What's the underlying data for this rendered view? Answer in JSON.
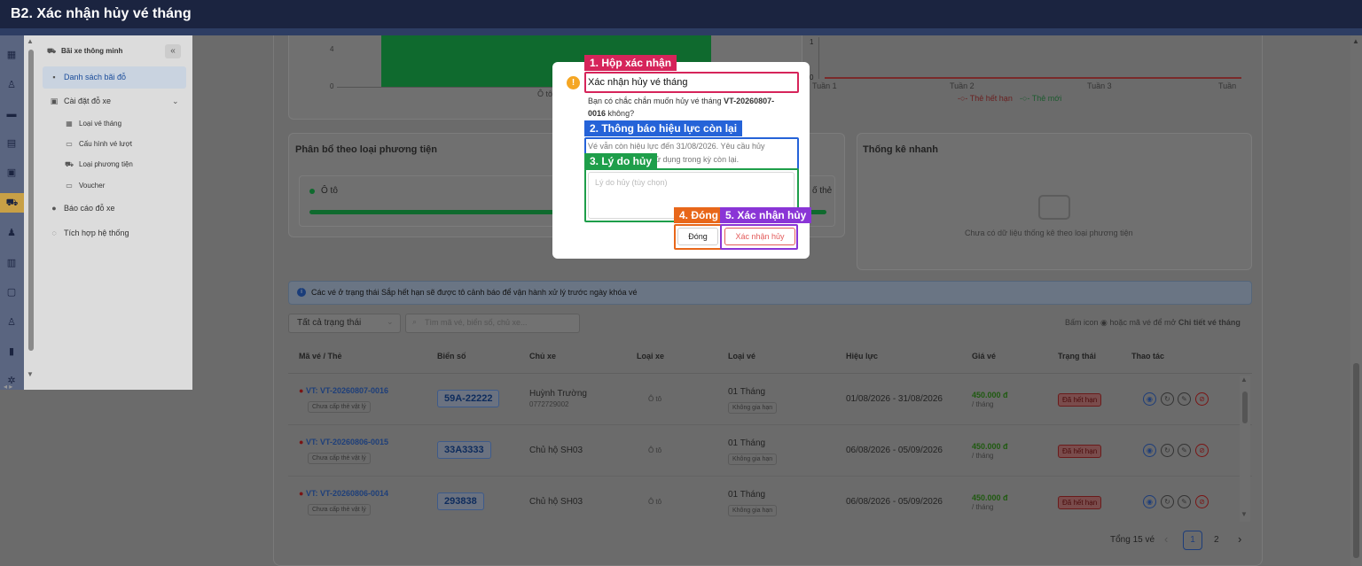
{
  "header": {
    "title": "B2. Xác nhận hủy vé tháng"
  },
  "sidebar": {
    "module": "Bãi xe thông minh",
    "items": [
      {
        "label": "Danh sách bãi đỗ"
      },
      {
        "label": "Cài đặt đỗ xe"
      },
      {
        "label": "Loại vé tháng"
      },
      {
        "label": "Cấu hình vé lượt"
      },
      {
        "label": "Loại phương tiện"
      },
      {
        "label": "Voucher"
      },
      {
        "label": "Báo cáo đỗ xe"
      },
      {
        "label": "Tích hợp hệ thống"
      }
    ]
  },
  "chart_top_left": {
    "y_ticks": [
      "4",
      "0"
    ],
    "x_label": "Ô tô"
  },
  "chart_top_right": {
    "y_ticks": [
      "1",
      "0"
    ],
    "x_labels": [
      "Tuần 1",
      "Tuần 2",
      "Tuần 3",
      "Tuần"
    ],
    "legend": [
      "Thẻ hết hạn",
      "Thẻ mới"
    ]
  },
  "vehicle_card": {
    "title": "Phân bổ theo loại phương tiện",
    "item": "Ô tô",
    "right_text": "ố thẻ"
  },
  "stats_card": {
    "title": "Thống kê nhanh",
    "empty": "Chưa có dữ liệu thống kê theo loại phương tiện"
  },
  "info": {
    "text": "Các vé ở trạng thái Sắp hết hạn sẽ được tô cảnh báo để vận hành xử lý trước ngày khóa vé"
  },
  "filters": {
    "status": "Tất cả trạng thái",
    "search_placeholder": "Tìm mã vé, biển số, chủ xe...",
    "hint_prefix": "Bấm icon",
    "hint_middle": "hoặc mã vé để mở",
    "hint_bold": "Chi tiết vé tháng"
  },
  "table": {
    "headers": [
      "Mã vé / Thẻ",
      "Biển số",
      "Chủ xe",
      "Loại xe",
      "Loại vé",
      "Hiệu lực",
      "Giá vé",
      "Trạng thái",
      "Thao tác"
    ],
    "rows": [
      {
        "code": "VT: VT-20260807-0016",
        "card": "Chưa cấp thẻ vật lý",
        "plate": "59A-22222",
        "owner": "Huỳnh Trường",
        "phone": "0772729002",
        "vtype": "Ô tô",
        "ticket": "01 Tháng",
        "ticket_sub": "Không gia hạn",
        "validity": "01/08/2026 - 31/08/2026",
        "price": "450.000 đ",
        "per": "/ tháng",
        "status": "Đã hết hạn"
      },
      {
        "code": "VT: VT-20260806-0015",
        "card": "Chưa cấp thẻ vật lý",
        "plate": "33A3333",
        "owner": "Chủ hộ SH03",
        "phone": "",
        "vtype": "Ô tô",
        "ticket": "01 Tháng",
        "ticket_sub": "Không gia hạn",
        "validity": "06/08/2026 - 05/09/2026",
        "price": "450.000 đ",
        "per": "/ tháng",
        "status": "Đã hết hạn"
      },
      {
        "code": "VT: VT-20260806-0014",
        "card": "Chưa cấp thẻ vật lý",
        "plate": "293838",
        "owner": "Chủ hộ SH03",
        "phone": "",
        "vtype": "Ô tô",
        "ticket": "01 Tháng",
        "ticket_sub": "Không gia hạn",
        "validity": "06/08/2026 - 05/09/2026",
        "price": "450.000 đ",
        "per": "/ tháng",
        "status": "Đã hết hạn"
      }
    ]
  },
  "pagination": {
    "total": "Tổng 15 vé",
    "pages": [
      "1",
      "2"
    ],
    "prev": "‹",
    "next": "›"
  },
  "modal": {
    "title": "Xác nhận hủy vé tháng",
    "question_prefix": "Bạn có chắc chắn muốn hủy vé tháng",
    "ticket_code_1": "VT-20260807-",
    "ticket_code_2": "0016",
    "question_suffix": "không?",
    "notice_1": "Vé vẫn còn hiệu lực đến 31/08/2026. Yêu cầu hủy",
    "notice_2": "ử dụng trong kỳ còn lại.",
    "reason_placeholder": "Lý do hủy (tùy chọn)",
    "close_button": "Đóng",
    "confirm_button": "Xác nhận hủy"
  },
  "annotations": [
    {
      "text": "1. Hộp xác nhận",
      "color": "#d6245a"
    },
    {
      "text": "2. Thông báo hiệu lực còn lại",
      "color": "#2563d8"
    },
    {
      "text": "3. Lý do hủy",
      "color": "#1e9e4a"
    },
    {
      "text": "4. Đóng",
      "color": "#e8671a"
    },
    {
      "text": "5. Xác nhận hủy",
      "color": "#8a35d6"
    }
  ]
}
